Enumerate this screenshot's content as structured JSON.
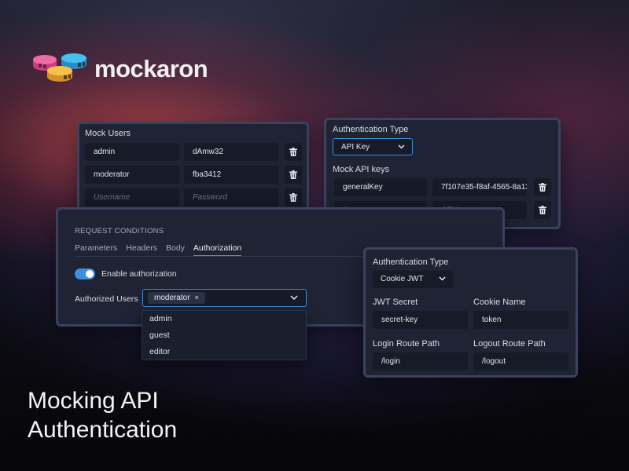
{
  "brand": {
    "name": "mockaron"
  },
  "headline": {
    "line1": "Mocking API",
    "line2": "Authentication"
  },
  "mock_users": {
    "title": "Mock Users",
    "rows": [
      {
        "username": "admin",
        "password": "dAmw32"
      },
      {
        "username": "moderator",
        "password": "fba3412"
      }
    ],
    "username_placeholder": "Username",
    "password_placeholder": "Password"
  },
  "api_key_auth": {
    "auth_type_label": "Authentication Type",
    "auth_type_value": "API Key",
    "keys_label": "Mock API keys",
    "keys": [
      {
        "name": "generalKey",
        "key": "7f107e35-f8af-4565-8a13"
      }
    ],
    "key_name_placeholder": "Key name",
    "api_key_placeholder": "API key"
  },
  "request_conditions": {
    "heading": "REQUEST CONDITIONS",
    "tabs": [
      "Parameters",
      "Headers",
      "Body",
      "Authorization"
    ],
    "active_tab": "Authorization",
    "enable_label": "Enable authorization",
    "enabled": true,
    "users_label": "Authorized Users",
    "selected_user": "moderator",
    "remove_glyph": "×",
    "options": [
      "admin",
      "guest",
      "editor"
    ]
  },
  "jwt_auth": {
    "auth_type_label": "Authentication Type",
    "auth_type_value": "Cookie JWT",
    "secret_label": "JWT Secret",
    "secret_value": "secret-key",
    "cookie_label": "Cookie Name",
    "cookie_value": "token",
    "login_label": "Login Route Path",
    "login_value": "/login",
    "logout_label": "Logout Route Path",
    "logout_value": "/logout"
  },
  "colors": {
    "accent": "#3d8fe0",
    "panel_bg": "#1f2334",
    "panel_border": "#3a4260",
    "input_bg": "#171a27",
    "logo_pink": "#f05a9a",
    "logo_blue": "#3cb2e6",
    "logo_yellow": "#f5b73a"
  },
  "icons": [
    "logo-icon",
    "trash-icon",
    "chevron-down-icon",
    "close-icon"
  ]
}
